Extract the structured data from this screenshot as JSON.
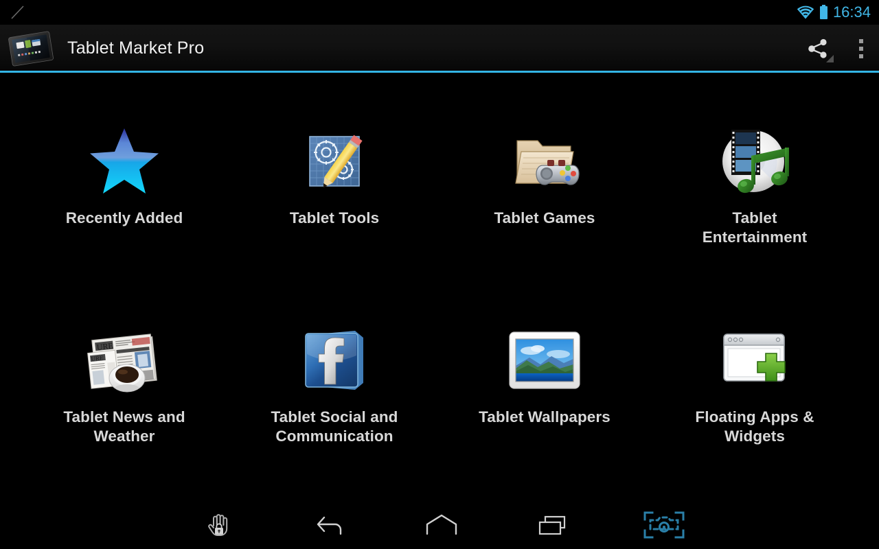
{
  "status_bar": {
    "left_indicator_icon": "stylus-line-icon",
    "wifi_icon": "wifi-icon",
    "battery_icon": "battery-icon",
    "time": "16:34",
    "accent_color": "#41b6e6"
  },
  "action_bar": {
    "app_icon": "tablet-device-icon",
    "title": "Tablet Market Pro",
    "share_icon": "share-icon",
    "overflow_icon": "overflow-menu-icon",
    "underline_color": "#33b5e5"
  },
  "grid": {
    "items": [
      {
        "label": "Recently Added",
        "icon": "star-icon"
      },
      {
        "label": "Tablet Tools",
        "icon": "gears-pencil-icon"
      },
      {
        "label": "Tablet Games",
        "icon": "folder-gamepad-icon"
      },
      {
        "label": "Tablet Entertainment",
        "icon": "disc-film-music-icon"
      },
      {
        "label": "Tablet News and Weather",
        "icon": "newspaper-coffee-icon"
      },
      {
        "label": "Tablet Social and Communication",
        "icon": "facebook-icon"
      },
      {
        "label": "Tablet Wallpapers",
        "icon": "photo-landscape-icon"
      },
      {
        "label": "Floating Apps & Widgets",
        "icon": "window-plus-icon"
      }
    ]
  },
  "nav_bar": {
    "buttons": [
      {
        "name": "screen-pin-lock-icon",
        "label": "Screen Pin"
      },
      {
        "name": "back-icon",
        "label": "Back"
      },
      {
        "name": "home-icon",
        "label": "Home"
      },
      {
        "name": "recent-apps-icon",
        "label": "Recent Apps"
      },
      {
        "name": "screenshot-icon",
        "label": "Screenshot"
      }
    ],
    "screenshot_icon_color": "#2a7fa8"
  }
}
